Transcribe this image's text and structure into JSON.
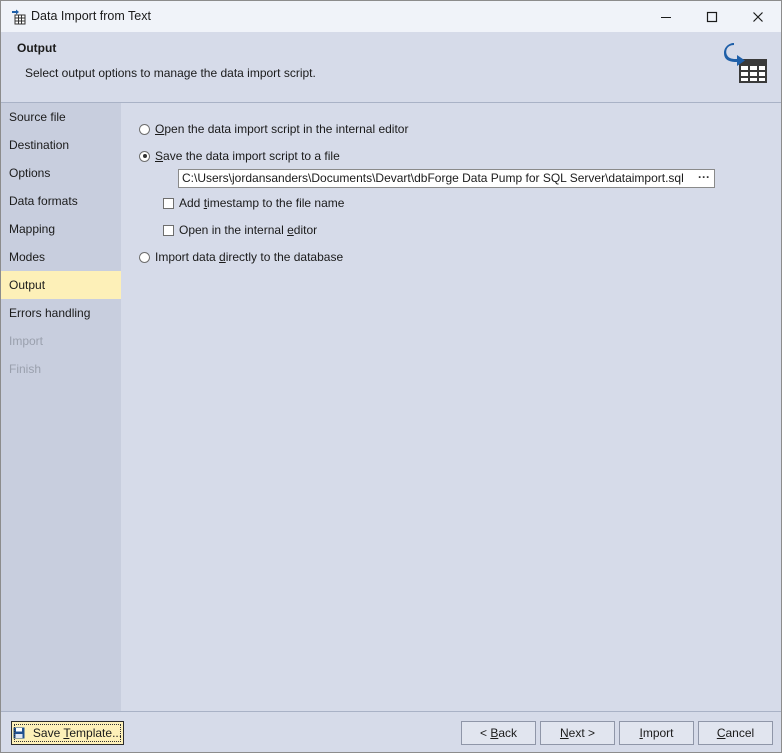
{
  "window": {
    "title": "Data Import from Text"
  },
  "header": {
    "title": "Output",
    "description": "Select output options to manage the data import script."
  },
  "sidebar": {
    "items": [
      {
        "label": "Source file",
        "state": "normal"
      },
      {
        "label": "Destination",
        "state": "normal"
      },
      {
        "label": "Options",
        "state": "normal"
      },
      {
        "label": "Data formats",
        "state": "normal"
      },
      {
        "label": "Mapping",
        "state": "normal"
      },
      {
        "label": "Modes",
        "state": "normal"
      },
      {
        "label": "Output",
        "state": "active"
      },
      {
        "label": "Errors handling",
        "state": "normal"
      },
      {
        "label": "Import",
        "state": "disabled"
      },
      {
        "label": "Finish",
        "state": "disabled"
      }
    ]
  },
  "options": {
    "open_editor": {
      "pre": "",
      "u": "O",
      "post": "pen the data import script in the internal editor",
      "selected": false
    },
    "save_to_file": {
      "pre": "",
      "u": "S",
      "post": "ave the data import script to a file",
      "selected": true
    },
    "file_path": "C:\\Users\\jordansanders\\Documents\\Devart\\dbForge Data Pump for SQL Server\\dataimport.sql",
    "browse_label": "···",
    "add_timestamp": {
      "pre": "Add ",
      "u": "t",
      "post": "imestamp to the file name",
      "checked": false
    },
    "open_internal": {
      "pre": "Open in the internal ",
      "u": "e",
      "post": "ditor",
      "checked": false
    },
    "import_directly": {
      "pre": "Import data ",
      "u": "d",
      "post": "irectly to the database",
      "selected": false
    }
  },
  "footer": {
    "save_template": {
      "pre": "Save ",
      "u": "T",
      "post": "emplate..."
    },
    "back": {
      "pre": "< ",
      "u": "B",
      "post": "ack"
    },
    "next": {
      "pre": "",
      "u": "N",
      "post": "ext >"
    },
    "import": {
      "pre": "",
      "u": "I",
      "post": "mport"
    },
    "cancel": {
      "pre": "",
      "u": "C",
      "post": "ancel"
    }
  },
  "colors": {
    "active_nav": "#fdf0b8",
    "sidebar_bg": "#c8cede",
    "content_bg": "#d6dbe9",
    "accent_icon": "#1f5fa8"
  }
}
